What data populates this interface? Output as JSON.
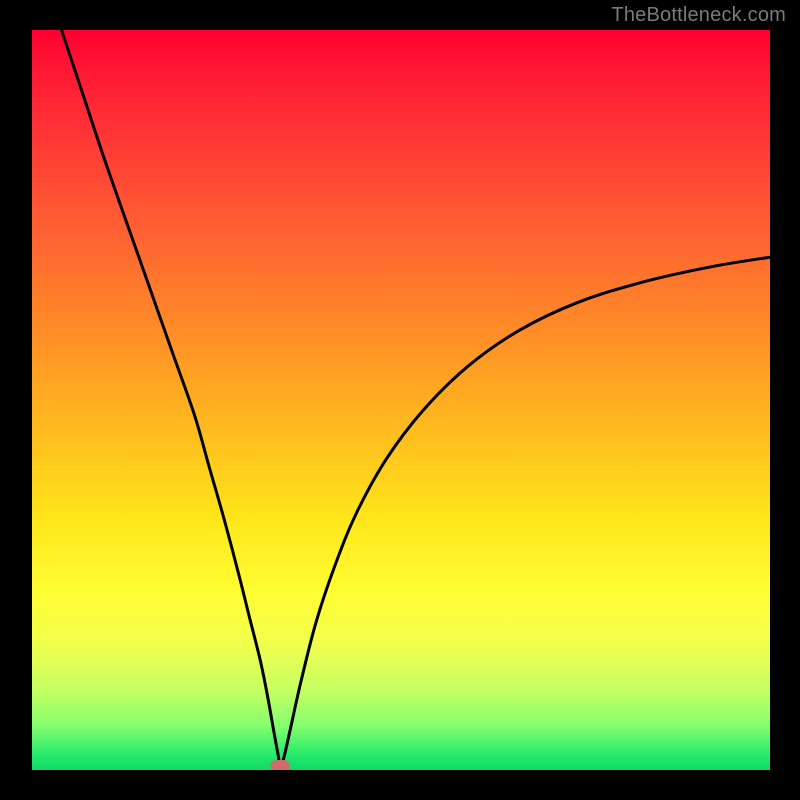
{
  "watermark": {
    "text": "TheBottleneck.com"
  },
  "colors": {
    "page_bg": "#000000",
    "curve": "#000000",
    "dot": "#cf6b6b",
    "watermark": "#7a7a7a"
  },
  "chart_data": {
    "type": "line",
    "title": "",
    "xlabel": "",
    "ylabel": "",
    "xlim": [
      0,
      100
    ],
    "ylim": [
      0,
      100
    ],
    "grid": false,
    "legend": false,
    "series": [
      {
        "name": "bottleneck-curve",
        "x": [
          4,
          7,
          10,
          13,
          16,
          19,
          22,
          24,
          26,
          28,
          29.5,
          31,
          32,
          32.8,
          33.3,
          33.6,
          34,
          35,
          36.5,
          38.5,
          41,
          44,
          48,
          53,
          59,
          66,
          74,
          83,
          92,
          100
        ],
        "y": [
          100,
          91,
          82,
          73.5,
          65,
          56.5,
          48,
          41,
          34,
          26.5,
          20.5,
          14.5,
          9.5,
          5,
          2.3,
          0.8,
          1.2,
          5.5,
          12.2,
          20,
          27.5,
          34.8,
          42,
          48.6,
          54.5,
          59.4,
          63.2,
          66,
          68,
          69.3
        ]
      }
    ],
    "marker": {
      "x": 33.6,
      "y": 0.6
    },
    "background_gradient_stops": [
      {
        "pos": 0.0,
        "color": "#ff0030"
      },
      {
        "pos": 0.06,
        "color": "#ff1a33"
      },
      {
        "pos": 0.14,
        "color": "#ff3536"
      },
      {
        "pos": 0.25,
        "color": "#ff5a33"
      },
      {
        "pos": 0.4,
        "color": "#ff8a28"
      },
      {
        "pos": 0.52,
        "color": "#ffb41f"
      },
      {
        "pos": 0.66,
        "color": "#ffe61a"
      },
      {
        "pos": 0.76,
        "color": "#fffe33"
      },
      {
        "pos": 0.83,
        "color": "#f1ff4d"
      },
      {
        "pos": 0.89,
        "color": "#c7ff62"
      },
      {
        "pos": 0.94,
        "color": "#84ff6d"
      },
      {
        "pos": 0.98,
        "color": "#26ea6c"
      },
      {
        "pos": 1.0,
        "color": "#0fd968"
      }
    ]
  }
}
